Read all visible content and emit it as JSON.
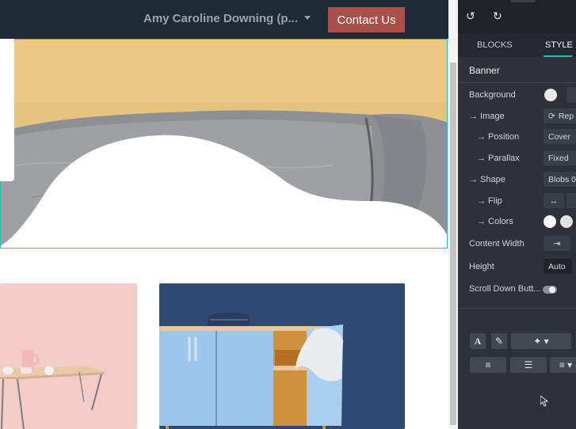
{
  "navbar": {
    "user_menu_label": "Amy Caroline Downing (p...",
    "contact_button_label": "Contact Us"
  },
  "editor": {
    "tabs": [
      "BLOCKS",
      "STYLE"
    ],
    "active_tab": "STYLE",
    "section_title": "Banner",
    "rows": {
      "background": "Background",
      "image": "→ Image",
      "image_value": "Rep",
      "position": "→ Position",
      "position_value": "Cover",
      "parallax": "→ Parallax",
      "parallax_value": "Fixed",
      "shape": "→ Shape",
      "shape_value": "Blobs 0",
      "flip": "→ Flip",
      "colors": "→ Colors",
      "content_width": "Content Width",
      "height": "Height",
      "height_value": "Auto",
      "scroll_down": "Scroll Down Butt..."
    },
    "scroll_down_enabled": false,
    "icons": [
      "undo-icon",
      "redo-icon",
      "refresh-icon",
      "flip-horizontal-icon",
      "font-color-icon",
      "paint-brush-icon",
      "magic-wand-icon",
      "unordered-list-icon",
      "ordered-list-icon",
      "align-icon"
    ]
  },
  "colors": {
    "navbar_bg": "#1f2b34",
    "contact_button": "#a9504a",
    "accent": "#2bb9c0",
    "panel_bg": "#2e3138",
    "banner_wall": "#e6c47e",
    "card1_bg": "#f1c8c2",
    "card2_bg": "#2f4a72"
  }
}
